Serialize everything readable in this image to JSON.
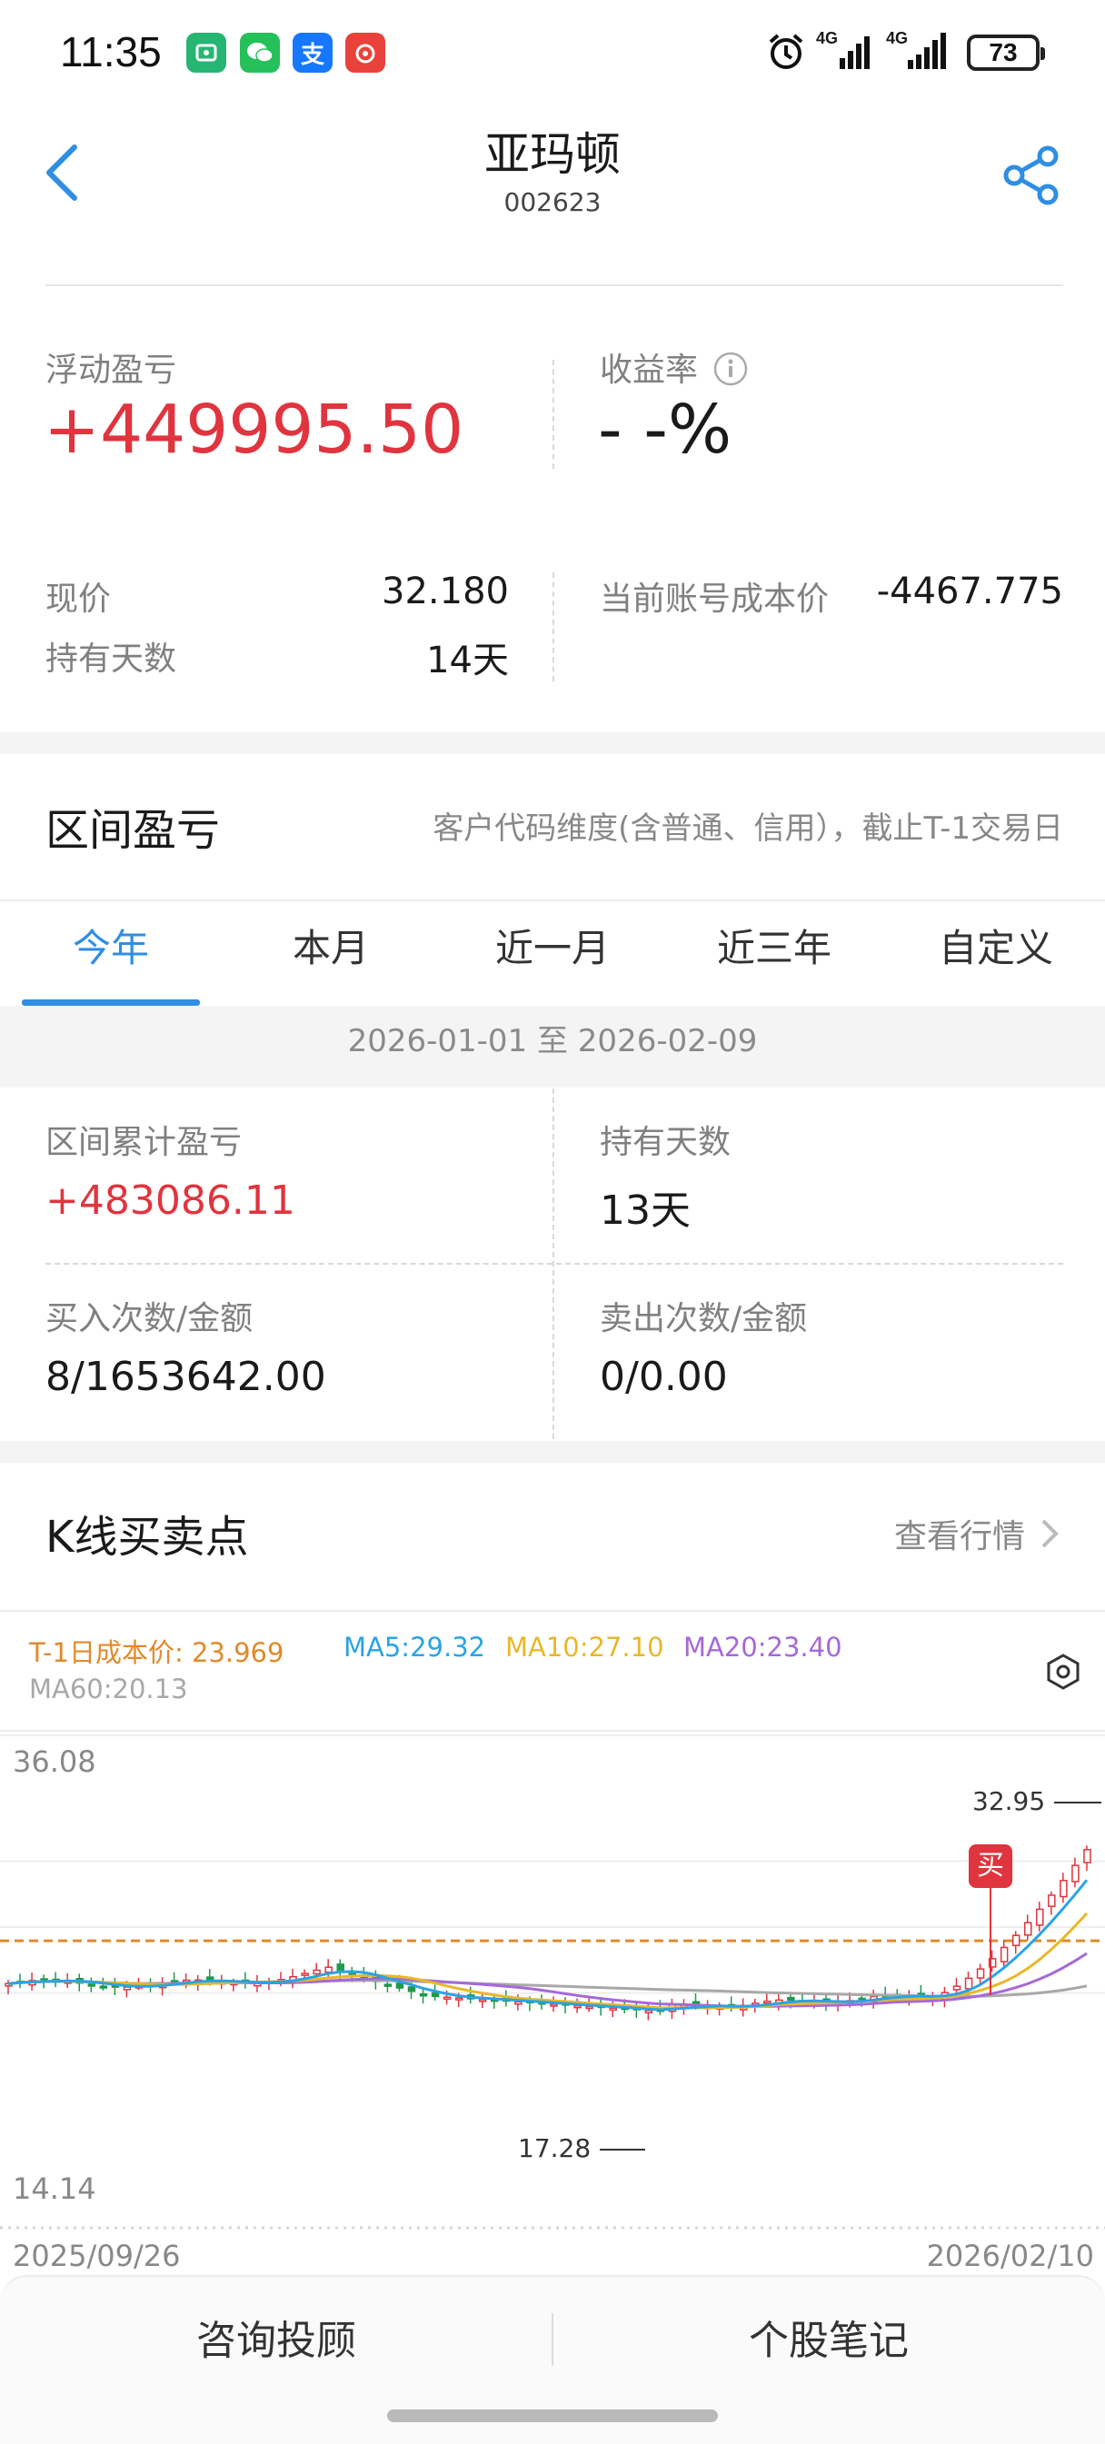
{
  "status_bar": {
    "time": "11:35",
    "battery": "73",
    "signal_1": "4G",
    "signal_2": "4G",
    "alipay_char": "支"
  },
  "header": {
    "title": "亚玛顿",
    "code": "002623"
  },
  "summary": {
    "float_pl_label": "浮动盈亏",
    "float_pl_value": "+449995.50",
    "return_label": "收益率",
    "return_value": "- -%",
    "price_label": "现价",
    "price_value": "32.180",
    "hold_days_label": "持有天数",
    "hold_days_value": "14天",
    "cost_label": "当前账号成本价",
    "cost_value": "-4467.775"
  },
  "interval": {
    "title": "区间盈亏",
    "note": "客户代码维度(含普通、信用），截止T-1交易日",
    "tabs": [
      "今年",
      "本月",
      "近一月",
      "近三年",
      "自定义"
    ],
    "active_tab": 0,
    "date_range": "2026-01-01 至 2026-02-09",
    "cum_pl_label": "区间累计盈亏",
    "cum_pl_value": "+483086.11",
    "hold_days_label": "持有天数",
    "hold_days_value": "13天",
    "buy_label": "买入次数/金额",
    "buy_value": "8/1653642.00",
    "sell_label": "卖出次数/金额",
    "sell_value": "0/0.00"
  },
  "kline": {
    "title": "K线买卖点",
    "view_label": "查看行情",
    "legend": {
      "cost": "T-1日成本价: 23.969",
      "ma5": "MA5:29.32",
      "ma10": "MA10:27.10",
      "ma20": "MA20:23.40",
      "ma60": "MA60:20.13"
    },
    "y_max": "36.08",
    "y_min": "14.14",
    "high_label": "32.95",
    "low_label": "17.28",
    "buy_marker": "买",
    "x_start": "2025/09/26",
    "x_end": "2026/02/10",
    "colors": {
      "cost": "#e08a2c",
      "ma5": "#2aa3e6",
      "ma10": "#e8b82a",
      "ma20": "#a569d8",
      "ma60": "#a8a8a8",
      "up": "#e0343e",
      "down": "#1f9a4a"
    }
  },
  "footer": {
    "consult": "咨询投顾",
    "notes": "个股笔记"
  }
}
